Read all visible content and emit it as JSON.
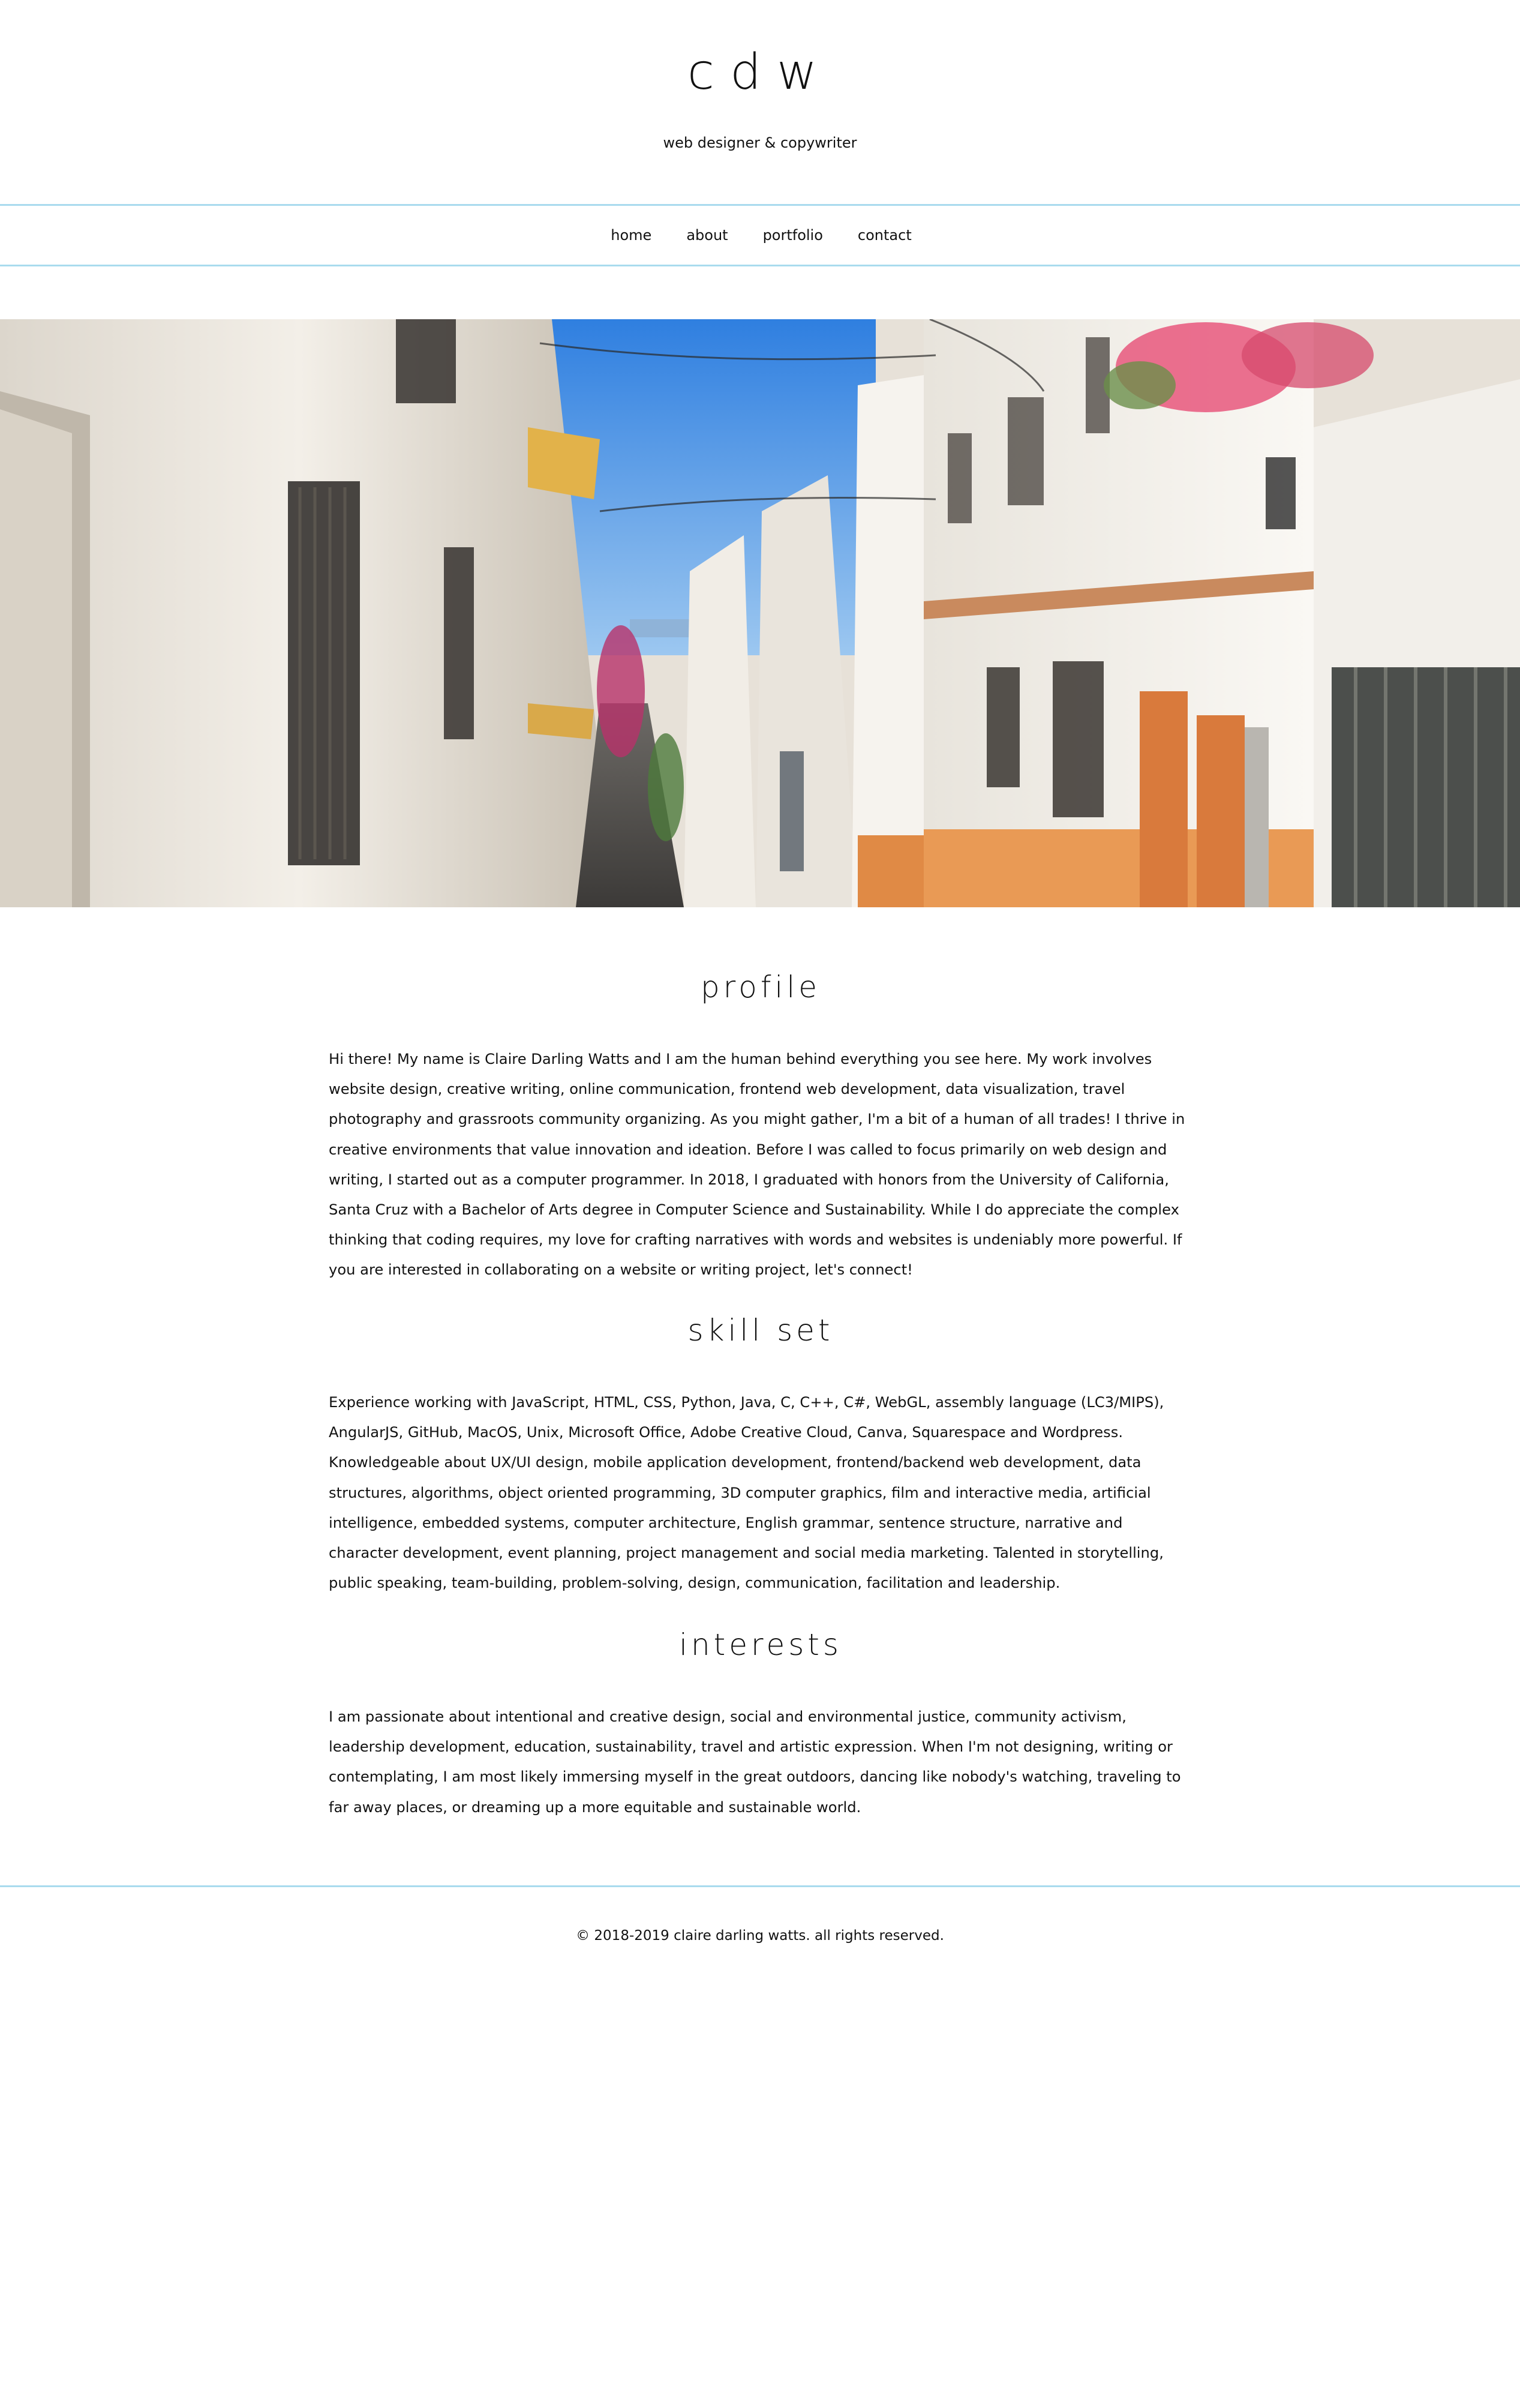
{
  "header": {
    "logo": "cdw",
    "tagline": "web designer & copywriter"
  },
  "nav": {
    "items": [
      {
        "label": "home"
      },
      {
        "label": "about"
      },
      {
        "label": "portfolio"
      },
      {
        "label": "contact"
      }
    ]
  },
  "sections": {
    "profile": {
      "title": "profile",
      "text": "Hi there! My name is Claire Darling Watts and I am the human behind everything you see here. My work involves website design, creative writing, online communication, frontend web development, data visualization, travel photography and grassroots community organizing. As you might gather, I'm a bit of a human of all trades! I thrive in creative environments that value innovation and ideation. Before I was called to focus primarily on web design and writing, I started out as a computer programmer. In 2018, I graduated with honors from the University of California, Santa Cruz with a Bachelor of Arts degree in Computer Science and Sustainability. While I do appreciate the complex thinking that coding requires, my love for crafting narratives with words and websites is undeniably more powerful. If you are interested in collaborating on a website or writing project, let's connect!"
    },
    "skills": {
      "title": "skill set",
      "text": "Experience working with JavaScript, HTML, CSS, Python, Java, C, C++, C#, WebGL, assembly language (LC3/MIPS), AngularJS, GitHub, MacOS, Unix, Microsoft Office, Adobe Creative Cloud, Canva, Squarespace and Wordpress. Knowledgeable about UX/UI design, mobile application development, frontend/backend web development, data structures, algorithms, object oriented programming, 3D computer graphics, film and interactive media, artificial intelligence, embedded systems, computer architecture, English grammar, sentence structure, narrative and character development, event planning, project management and social media marketing. Talented in storytelling, public speaking, team-building, problem-solving, design, communication, facilitation and leadership."
    },
    "interests": {
      "title": "interests",
      "text": "I am passionate about intentional and creative design, social and environmental justice, community activism, leadership development, education, sustainability, travel and artistic expression. When I'm not designing, writing or contemplating, I am most likely immersing myself in the great outdoors, dancing like nobody's watching, traveling to far away places, or dreaming up a more equitable and sustainable world."
    }
  },
  "footer": {
    "text": "© 2018-2019 claire darling watts. all rights reserved."
  },
  "colors": {
    "rule": "#a9dbee",
    "text": "#111111",
    "sky": "#3f8fe6"
  }
}
